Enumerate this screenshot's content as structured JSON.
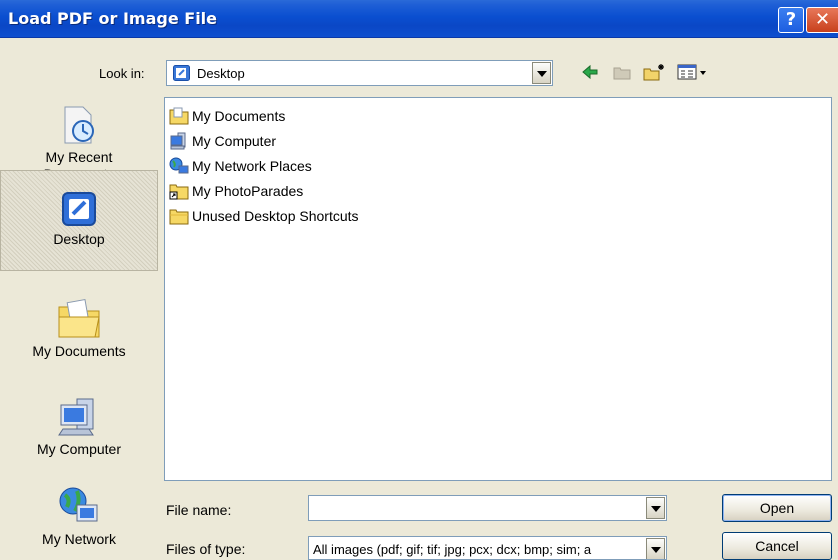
{
  "window": {
    "title": "Load PDF or Image File",
    "help_glyph": "?",
    "close_glyph": "✕"
  },
  "lookin": {
    "label": "Look in:",
    "value": "Desktop"
  },
  "toolbar_icons": [
    "back-arrow-icon",
    "up-folder-icon",
    "new-folder-icon",
    "view-menu-icon"
  ],
  "places": [
    {
      "label": "My Recent Documents",
      "line1": "My Recent",
      "line2": "Documents",
      "icon": "recent-documents-icon",
      "selected": false
    },
    {
      "label": "Desktop",
      "icon": "desktop-icon",
      "selected": true
    },
    {
      "label": "My Documents",
      "icon": "my-documents-icon",
      "selected": false
    },
    {
      "label": "My Computer",
      "icon": "my-computer-icon",
      "selected": false
    },
    {
      "label": "My Network",
      "icon": "my-network-icon",
      "selected": false
    }
  ],
  "files": [
    {
      "name": "My Documents",
      "icon": "my-documents-icon"
    },
    {
      "name": "My Computer",
      "icon": "my-computer-icon"
    },
    {
      "name": "My Network Places",
      "icon": "network-places-icon"
    },
    {
      "name": "My PhotoParades",
      "icon": "shortcut-folder-icon"
    },
    {
      "name": "Unused Desktop Shortcuts",
      "icon": "folder-icon"
    }
  ],
  "filename": {
    "label": "File name:",
    "value": ""
  },
  "filetype": {
    "label": "Files of type:",
    "value": "All images (pdf; gif; tif; jpg; pcx; dcx; bmp; sim; a"
  },
  "buttons": {
    "open": "Open",
    "cancel": "Cancel"
  }
}
